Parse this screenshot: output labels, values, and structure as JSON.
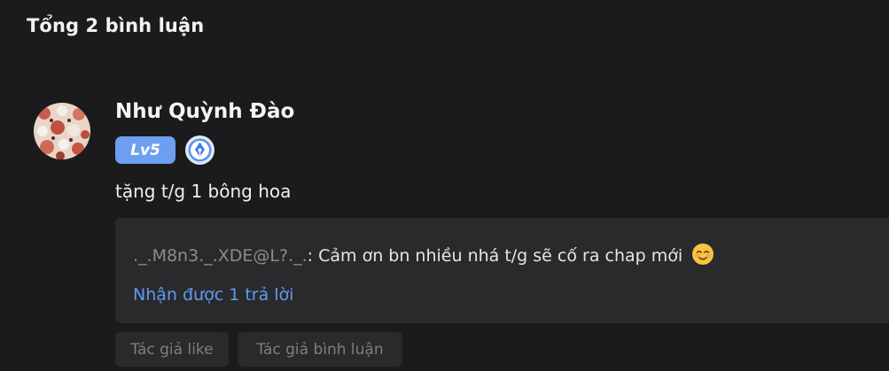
{
  "header": {
    "total_comments": "Tổng 2 bình luận"
  },
  "comment": {
    "user_name": "Như Quỳnh Đào",
    "level": "Lv5",
    "text": "tặng t/g 1 bông hoa",
    "reply": {
      "author": "._.M8n3._.XDE@L?._.",
      "separator": ": ",
      "text": "Cảm ơn bn nhiều nhá t/g sẽ cố ra chap mới",
      "emoji": "smiling-face-emoji"
    },
    "reply_count": "Nhận được 1 trả lời",
    "tags": {
      "author_like": "Tác giả like",
      "author_comment": "Tác giả bình luận"
    }
  },
  "colors": {
    "background": "#1b1b1d",
    "panel": "#2a2a2c",
    "level_badge": "#6d9ff0",
    "link": "#5d9bf0"
  }
}
